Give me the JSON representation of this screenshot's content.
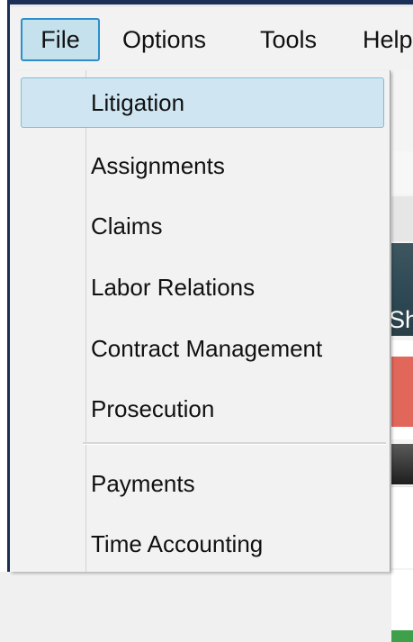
{
  "menubar": {
    "items": [
      {
        "label": "File"
      },
      {
        "label": "Options"
      },
      {
        "label": "Tools"
      },
      {
        "label": "Help"
      }
    ]
  },
  "file_menu": {
    "items": [
      {
        "label": "Litigation"
      },
      {
        "label": "Assignments"
      },
      {
        "label": "Claims"
      },
      {
        "label": "Labor Relations"
      },
      {
        "label": "Contract Management"
      },
      {
        "label": "Prosecution"
      },
      {
        "label": "Payments"
      },
      {
        "label": "Time Accounting"
      }
    ]
  },
  "background": {
    "partial_text": "Sh",
    "accent_colors": {
      "menu_highlight": "#c5e1ee",
      "menu_highlight_border": "#2d8fc9",
      "window_border": "#1c2f56",
      "red_panel": "#e0675a",
      "green_strip": "#3ea04a"
    }
  }
}
